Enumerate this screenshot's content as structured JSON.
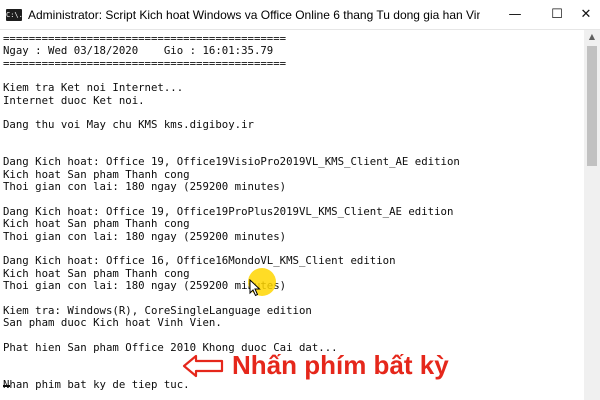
{
  "window": {
    "title": "Administrator:  Script Kich hoat Windows va Office Online 6 thang Tu dong gia han Vinh Vien - Copyright",
    "icon_label": "C:\\.",
    "controls": {
      "minimize": "—",
      "maximize": "☐",
      "close": "✕"
    }
  },
  "console": {
    "lines": [
      "============================================",
      "Ngay : Wed 03/18/2020    Gio : 16:01:35.79",
      "============================================",
      "",
      "Kiem tra Ket noi Internet...",
      "Internet duoc Ket noi.",
      "",
      "Dang thu voi May chu KMS kms.digiboy.ir",
      "",
      "",
      "Dang Kich hoat: Office 19, Office19VisioPro2019VL_KMS_Client_AE edition",
      "Kich hoat San pham Thanh cong",
      "Thoi gian con lai: 180 ngay (259200 minutes)",
      "",
      "Dang Kich hoat: Office 19, Office19ProPlus2019VL_KMS_Client_AE edition",
      "Kich hoat San pham Thanh cong",
      "Thoi gian con lai: 180 ngay (259200 minutes)",
      "",
      "Dang Kich hoat: Office 16, Office16MondoVL_KMS_Client edition",
      "Kich hoat San pham Thanh cong",
      "Thoi gian con lai: 180 ngay (259200 minutes)",
      "",
      "Kiem tra: Windows(R), CoreSingleLanguage edition",
      "San pham duoc Kich hoat Vinh Vien.",
      "",
      "Phat hien San pham Office 2010 Khong duoc Cai dat...",
      "",
      "",
      "Nhan phim bat ky de tiep tuc."
    ]
  },
  "annotation": {
    "text": "Nhấn phím bất kỳ",
    "color": "#e5271b",
    "arrow_icon": "left-arrow-icon"
  },
  "cursor_highlight_color": "#ffd600"
}
